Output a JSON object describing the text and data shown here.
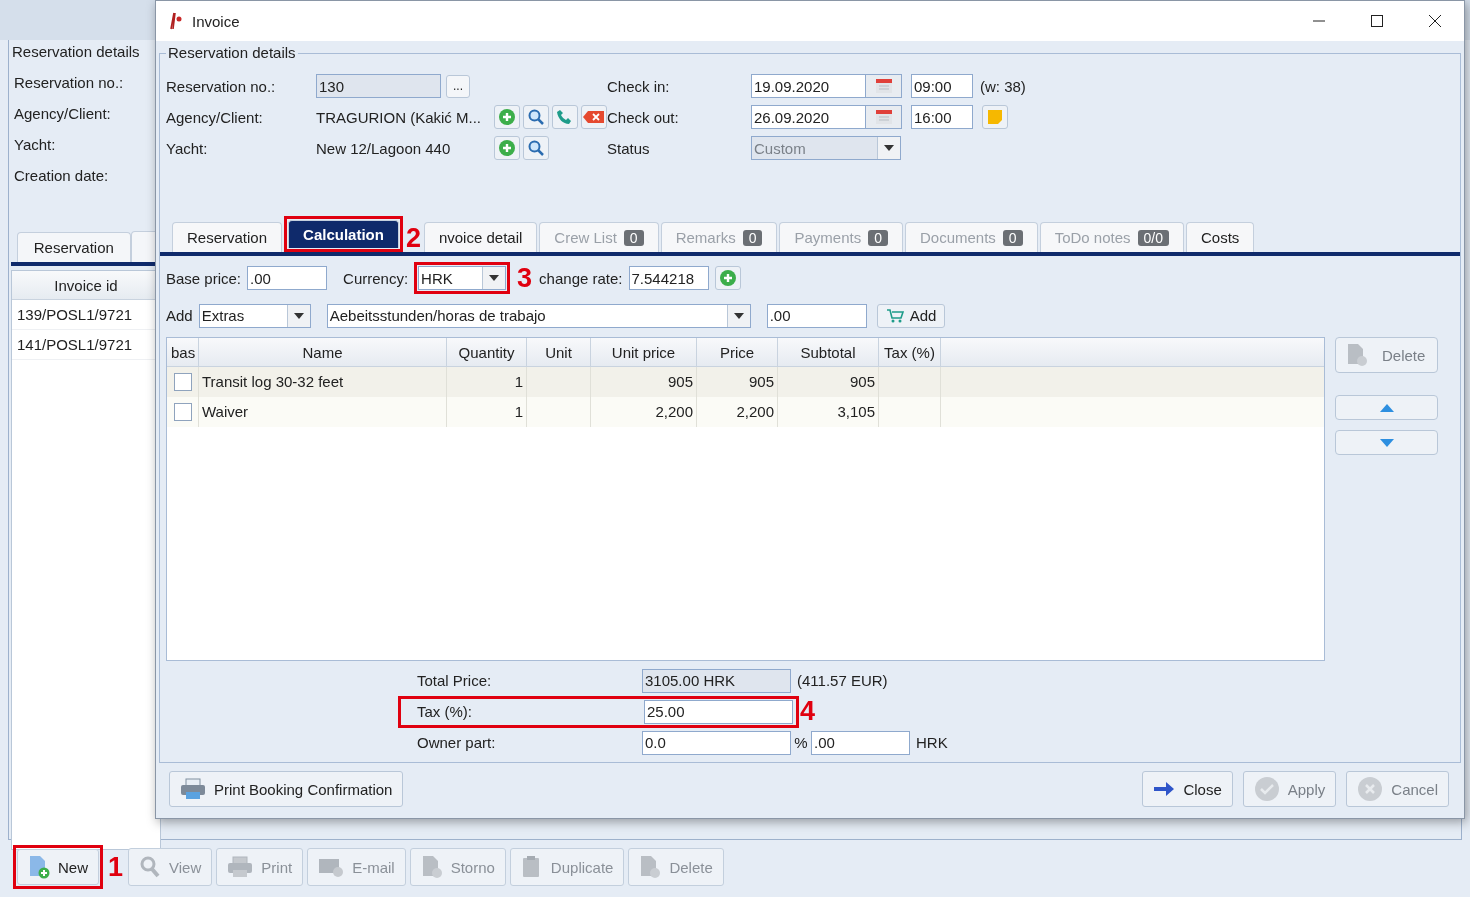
{
  "app": {
    "details_title": "Reservation details",
    "labels": [
      "Reservation no.:",
      "Agency/Client:",
      "Yacht:",
      "Creation date:"
    ],
    "tabs": [
      {
        "label": "Reservation",
        "selected": false
      }
    ],
    "invoices": {
      "column": "Invoice id",
      "rows": [
        "139/POSL1/9721",
        "141/POSL1/9721"
      ]
    },
    "toolbar": [
      {
        "label": "New",
        "kind": "new",
        "disabled": false,
        "callout": "1"
      },
      {
        "label": "View",
        "kind": "view",
        "disabled": true
      },
      {
        "label": "Print",
        "kind": "print",
        "disabled": true
      },
      {
        "label": "E-mail",
        "kind": "email",
        "disabled": true
      },
      {
        "label": "Storno",
        "kind": "document",
        "disabled": true
      },
      {
        "label": "Duplicate",
        "kind": "duplicate",
        "disabled": true
      },
      {
        "label": "Delete",
        "kind": "document",
        "disabled": true
      }
    ]
  },
  "dialog": {
    "title": "Invoice",
    "details_title": "Reservation details",
    "reservation_no": {
      "label": "Reservation no.:",
      "value": "130",
      "button": "..."
    },
    "agency": {
      "label": "Agency/Client:",
      "value": "TRAGURION (Kakić M...",
      "buttons": [
        {
          "kind": "add"
        },
        {
          "kind": "search"
        },
        {
          "kind": "phone"
        },
        {
          "kind": "remove"
        }
      ]
    },
    "yacht": {
      "label": "Yacht:",
      "value": "New 12/Lagoon 440",
      "buttons": [
        {
          "kind": "add"
        },
        {
          "kind": "search"
        }
      ]
    },
    "check_in": {
      "label": "Check in:",
      "date": "19.09.2020",
      "time": "09:00",
      "note": "(w: 38)"
    },
    "check_out": {
      "label": "Check out:",
      "date": "26.09.2020",
      "time": "16:00"
    },
    "status": {
      "label": "Status",
      "value": "Custom",
      "disabled": true
    },
    "tabs": [
      {
        "label": "Reservation",
        "selected": false,
        "disabled": false
      },
      {
        "label": "Calculation",
        "selected": true,
        "disabled": false,
        "callout": "2"
      },
      {
        "label": "nvoice detail",
        "selected": false,
        "disabled": false
      },
      {
        "label": "Crew List",
        "badge": "0",
        "selected": false,
        "disabled": true
      },
      {
        "label": "Remarks",
        "badge": "0",
        "selected": false,
        "disabled": true
      },
      {
        "label": "Payments",
        "badge": "0",
        "selected": false,
        "disabled": true
      },
      {
        "label": "Documents",
        "badge": "0",
        "selected": false,
        "disabled": true
      },
      {
        "label": "ToDo notes",
        "badge": "0/0",
        "selected": false,
        "disabled": true
      },
      {
        "label": "Costs",
        "selected": false,
        "disabled": false
      }
    ],
    "base_price": {
      "label": "Base price:",
      "value": ".00"
    },
    "currency": {
      "label": "Currency:",
      "value": "HRK",
      "callout": "3"
    },
    "exchange_rate": {
      "label": "change rate:",
      "value": "7.544218"
    },
    "add_row": {
      "label": "Add",
      "category": "Extras",
      "item": "Aebeitsstunden/horas de trabajo",
      "amount": ".00",
      "button": "Add"
    },
    "table": {
      "columns": [
        "bas",
        "Name",
        "Quantity",
        "Unit",
        "Unit price",
        "Price",
        "Subtotal",
        "Tax (%)"
      ],
      "rows": [
        {
          "checked": false,
          "cells": [
            "Transit log 30-32 feet",
            "1",
            "",
            "905",
            "905",
            "905",
            ""
          ]
        },
        {
          "checked": false,
          "cells": [
            "Waiver",
            "1",
            "",
            "2,200",
            "2,200",
            "3,105",
            ""
          ]
        }
      ]
    },
    "side_buttons": {
      "delete": {
        "label": "Delete",
        "disabled": true
      }
    },
    "totals": {
      "total_label": "Total Price:",
      "total": "3105.00 HRK",
      "total_eur": "(411.57 EUR)",
      "tax_label": "Tax (%):",
      "tax": "25.00",
      "tax_callout": "4",
      "owner_label": "Owner part:",
      "owner_percent": "0.0",
      "percent_sign": "%",
      "owner_amount": ".00",
      "owner_currency": "HRK"
    },
    "footer": {
      "print": "Print Booking Confirmation",
      "buttons": [
        {
          "label": "Close",
          "kind": "close",
          "disabled": false
        },
        {
          "label": "Apply",
          "kind": "apply",
          "disabled": true
        },
        {
          "label": "Cancel",
          "kind": "cancel",
          "disabled": true
        }
      ]
    }
  }
}
